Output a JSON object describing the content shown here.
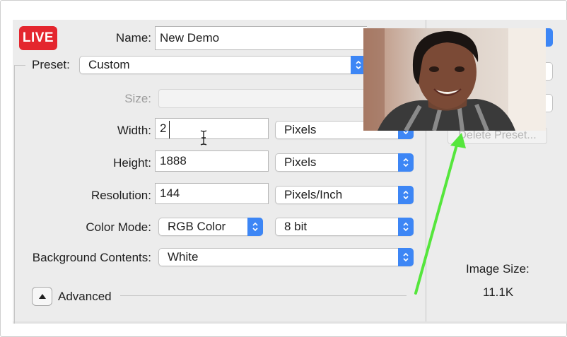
{
  "live_badge": "LIVE",
  "name": {
    "label": "Name:",
    "value": "New Demo"
  },
  "preset": {
    "label": "Preset:",
    "value": "Custom"
  },
  "size": {
    "label": "Size:",
    "value": ""
  },
  "width": {
    "label": "Width:",
    "value": "2",
    "unit": "Pixels"
  },
  "height": {
    "label": "Height:",
    "value": "1888",
    "unit": "Pixels"
  },
  "resolution": {
    "label": "Resolution:",
    "value": "144",
    "unit": "Pixels/Inch"
  },
  "color_mode": {
    "label": "Color Mode:",
    "mode": "RGB Color",
    "depth": "8 bit"
  },
  "background": {
    "label": "Background Contents:",
    "value": "White"
  },
  "advanced": {
    "label": "Advanced"
  },
  "side": {
    "delete_preset": "Delete Preset...",
    "image_size_label": "Image Size:",
    "image_size_value": "11.1K"
  },
  "colors": {
    "accent": "#3d86f5",
    "live": "#e4262e",
    "arrow": "#55e63c"
  }
}
